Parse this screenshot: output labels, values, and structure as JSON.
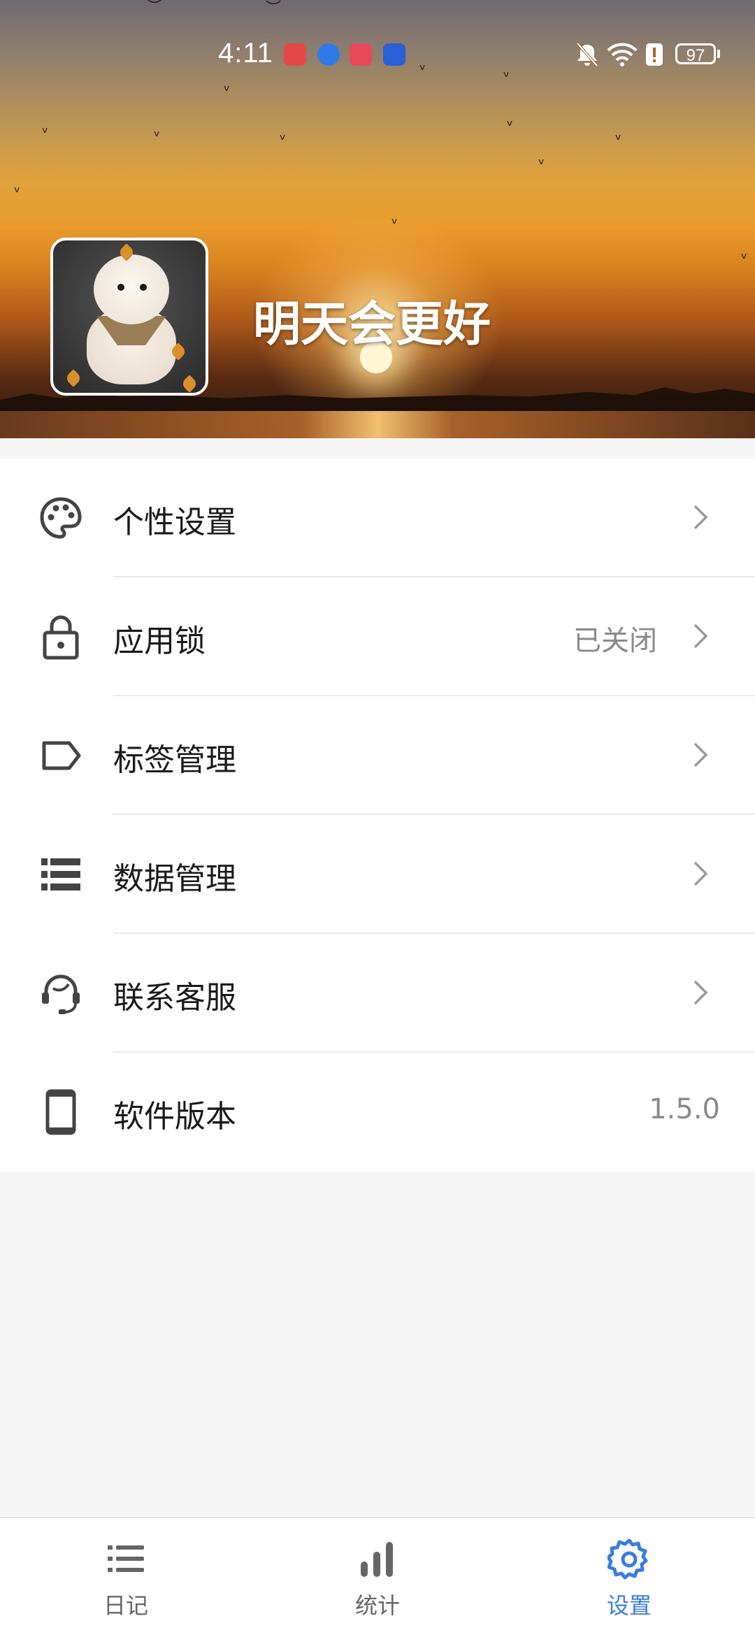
{
  "status_bar": {
    "time": "4:11",
    "battery": "97",
    "app_notifications": [
      "HUAWEI",
      "browser",
      "reader",
      "tips"
    ]
  },
  "profile": {
    "username": "明天会更好"
  },
  "settings": {
    "items": [
      {
        "label": "个性设置",
        "icon": "palette-icon",
        "value": "",
        "chevron": true
      },
      {
        "label": "应用锁",
        "icon": "lock-icon",
        "value": "已关闭",
        "chevron": true
      },
      {
        "label": "标签管理",
        "icon": "tag-icon",
        "value": "",
        "chevron": true
      },
      {
        "label": "数据管理",
        "icon": "data-list-icon",
        "value": "",
        "chevron": true
      },
      {
        "label": "联系客服",
        "icon": "customer-service-icon",
        "value": "",
        "chevron": true
      },
      {
        "label": "软件版本",
        "icon": "phone-icon",
        "value": "1.5.0",
        "chevron": false
      }
    ]
  },
  "bottom_nav": {
    "items": [
      {
        "label": "日记",
        "icon": "list-icon",
        "active": false
      },
      {
        "label": "统计",
        "icon": "bar-chart-icon",
        "active": false
      },
      {
        "label": "设置",
        "icon": "gear-icon",
        "active": true
      }
    ]
  },
  "colors": {
    "accent": "#3a7de0",
    "icon": "#444444",
    "secondary_text": "#8a8a8a"
  }
}
